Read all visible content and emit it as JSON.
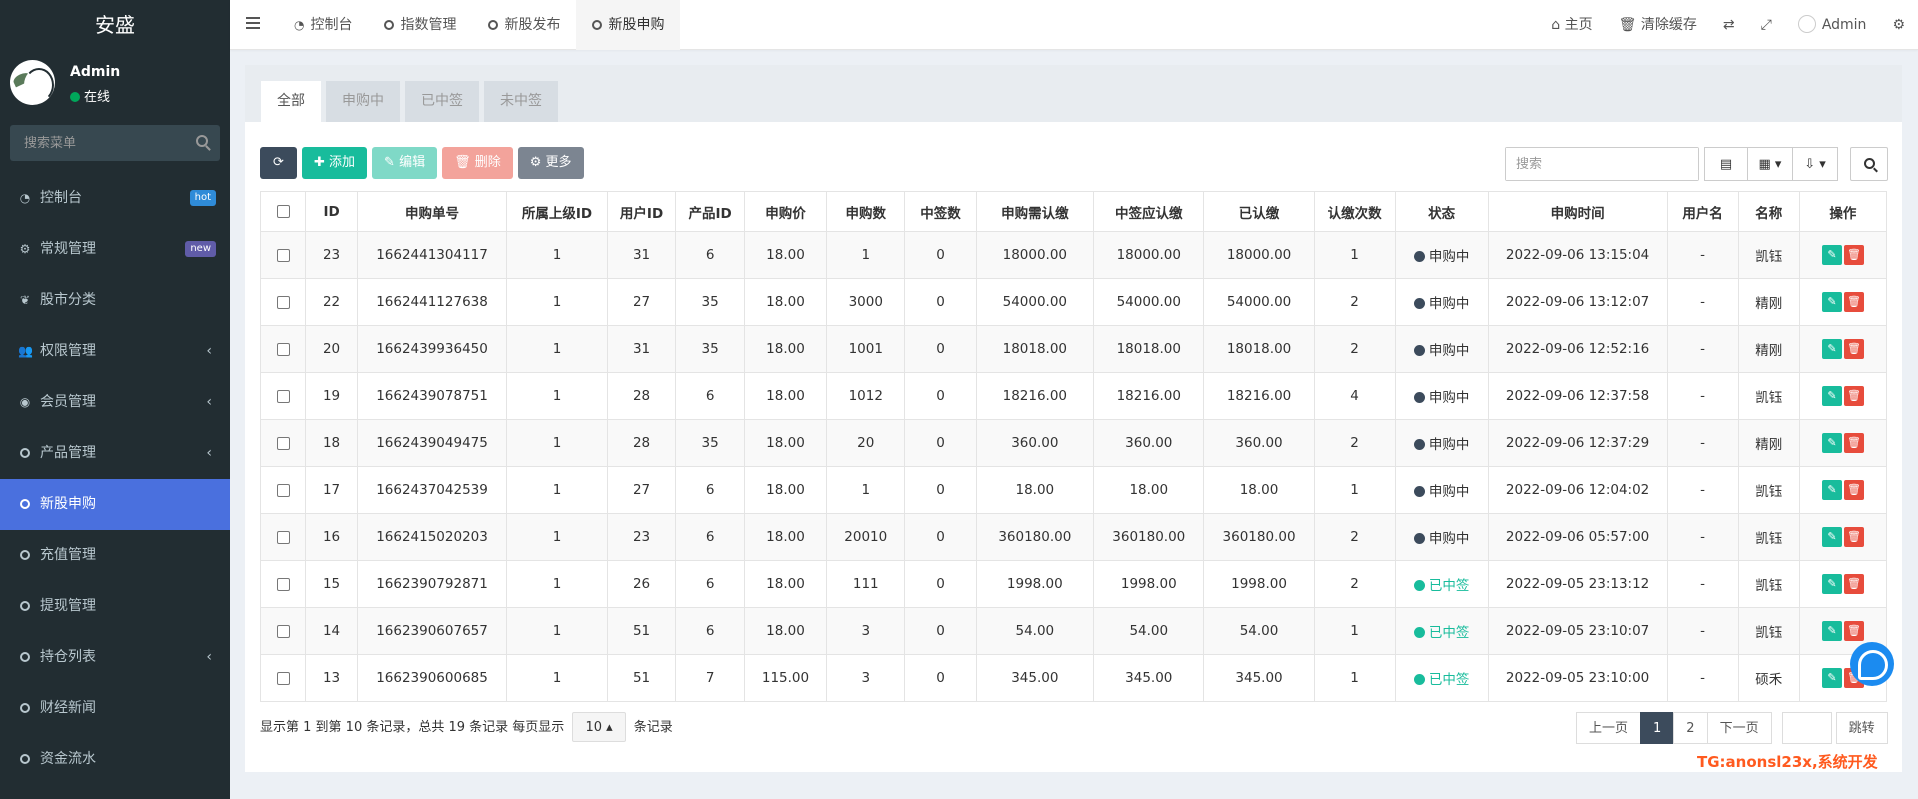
{
  "brand": "安盛",
  "user": {
    "name": "Admin",
    "status": "在线"
  },
  "sidebar_search": {
    "placeholder": "搜索菜单"
  },
  "menu": [
    {
      "label": "控制台",
      "badge": "hot"
    },
    {
      "label": "常规管理",
      "badge": "new"
    },
    {
      "label": "股市分类"
    },
    {
      "label": "权限管理",
      "arrow": true
    },
    {
      "label": "会员管理",
      "arrow": true
    },
    {
      "label": "产品管理",
      "arrow": true
    },
    {
      "label": "新股申购",
      "active": true
    },
    {
      "label": "充值管理"
    },
    {
      "label": "提现管理"
    },
    {
      "label": "持仓列表",
      "arrow": true
    },
    {
      "label": "财经新闻"
    },
    {
      "label": "资金流水"
    }
  ],
  "top_tabs": [
    {
      "label": "控制台",
      "icon": "dashboard-icon"
    },
    {
      "label": "指数管理",
      "icon": "circle-icon"
    },
    {
      "label": "新股发布",
      "icon": "circle-icon"
    },
    {
      "label": "新股申购",
      "icon": "circle-icon",
      "active": true
    }
  ],
  "top_right": {
    "home": "主页",
    "clear_cache": "清除缓存",
    "user": "Admin"
  },
  "panel_tabs": [
    "全部",
    "申购中",
    "已中签",
    "未中签"
  ],
  "toolbar": {
    "add": "添加",
    "edit": "编辑",
    "delete": "删除",
    "more": "更多"
  },
  "search": {
    "placeholder": "搜索"
  },
  "table": {
    "headers": [
      "ID",
      "申购单号",
      "所属上级ID",
      "用户ID",
      "产品ID",
      "申购价",
      "申购数",
      "中签数",
      "申购需认缴",
      "中签应认缴",
      "已认缴",
      "认缴次数",
      "状态",
      "申购时间",
      "用户名",
      "名称",
      "操作"
    ],
    "rows": [
      [
        "23",
        "1662441304117",
        "1",
        "31",
        "6",
        "18.00",
        "1",
        "0",
        "18000.00",
        "18000.00",
        "18000.00",
        "1",
        "申购中",
        "2022-09-06 13:15:04",
        "-",
        "凯钰"
      ],
      [
        "22",
        "1662441127638",
        "1",
        "27",
        "35",
        "18.00",
        "3000",
        "0",
        "54000.00",
        "54000.00",
        "54000.00",
        "2",
        "申购中",
        "2022-09-06 13:12:07",
        "-",
        "精刚"
      ],
      [
        "20",
        "1662439936450",
        "1",
        "31",
        "35",
        "18.00",
        "1001",
        "0",
        "18018.00",
        "18018.00",
        "18018.00",
        "2",
        "申购中",
        "2022-09-06 12:52:16",
        "-",
        "精刚"
      ],
      [
        "19",
        "1662439078751",
        "1",
        "28",
        "6",
        "18.00",
        "1012",
        "0",
        "18216.00",
        "18216.00",
        "18216.00",
        "4",
        "申购中",
        "2022-09-06 12:37:58",
        "-",
        "凯钰"
      ],
      [
        "18",
        "1662439049475",
        "1",
        "28",
        "35",
        "18.00",
        "20",
        "0",
        "360.00",
        "360.00",
        "360.00",
        "2",
        "申购中",
        "2022-09-06 12:37:29",
        "-",
        "精刚"
      ],
      [
        "17",
        "1662437042539",
        "1",
        "27",
        "6",
        "18.00",
        "1",
        "0",
        "18.00",
        "18.00",
        "18.00",
        "1",
        "申购中",
        "2022-09-06 12:04:02",
        "-",
        "凯钰"
      ],
      [
        "16",
        "1662415020203",
        "1",
        "23",
        "6",
        "18.00",
        "20010",
        "0",
        "360180.00",
        "360180.00",
        "360180.00",
        "2",
        "申购中",
        "2022-09-06 05:57:00",
        "-",
        "凯钰"
      ],
      [
        "15",
        "1662390792871",
        "1",
        "26",
        "6",
        "18.00",
        "111",
        "0",
        "1998.00",
        "1998.00",
        "1998.00",
        "2",
        "已中签",
        "2022-09-05 23:13:12",
        "-",
        "凯钰"
      ],
      [
        "14",
        "1662390607657",
        "1",
        "51",
        "6",
        "18.00",
        "3",
        "0",
        "54.00",
        "54.00",
        "54.00",
        "1",
        "已中签",
        "2022-09-05 23:10:07",
        "-",
        "凯钰"
      ],
      [
        "13",
        "1662390600685",
        "1",
        "51",
        "7",
        "115.00",
        "3",
        "0",
        "345.00",
        "345.00",
        "345.00",
        "1",
        "已中签",
        "2022-09-05 23:10:00",
        "-",
        "硕禾"
      ]
    ]
  },
  "footer": {
    "info": "显示第 1 到第 10 条记录，总共 19 条记录 每页显示",
    "page_size": "10",
    "suffix": "条记录"
  },
  "pager": {
    "prev": "上一页",
    "pages": [
      "1",
      "2"
    ],
    "next": "下一页",
    "go": "跳转"
  },
  "watermark": "TG:anonsl23x,系统开发",
  "colors": {
    "sidebar": "#222d32",
    "active": "#4a70de",
    "green": "#18bc9c",
    "red": "#e74c3c",
    "dark": "#3c4b5c"
  }
}
